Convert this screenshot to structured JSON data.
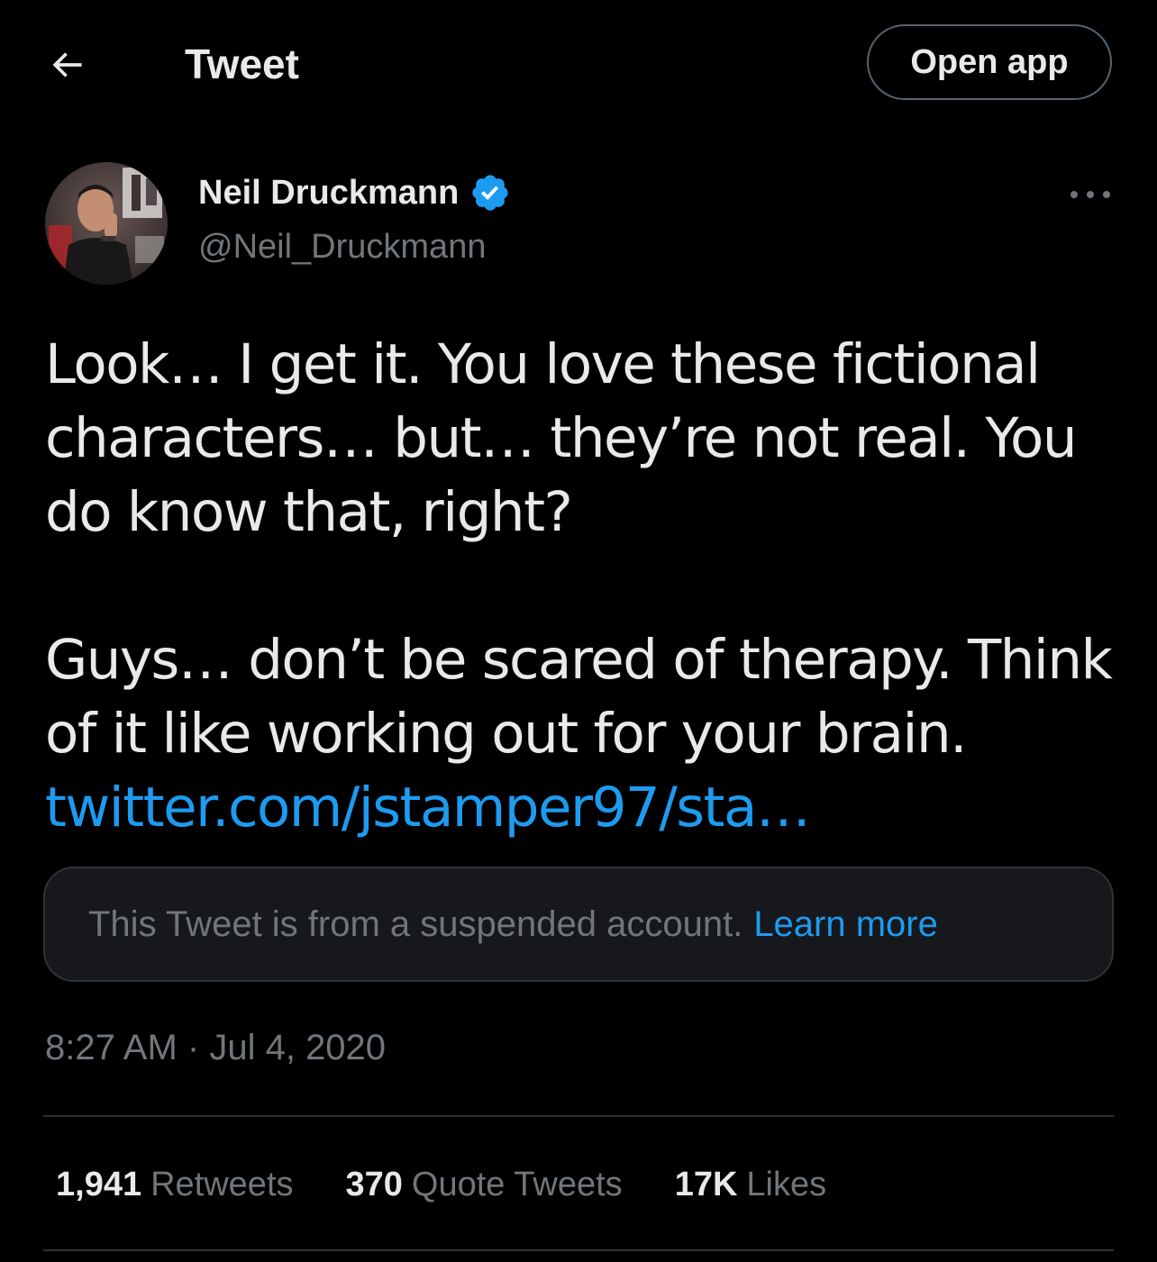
{
  "header": {
    "back_icon": "arrow-left-icon",
    "title": "Tweet",
    "open_app_label": "Open app"
  },
  "author": {
    "name": "Neil Druckmann",
    "handle": "@Neil_Druckmann",
    "verified_icon": "verified-badge-icon",
    "more_icon": "more-horizontal-icon"
  },
  "tweet": {
    "paragraph_1": "Look… I get it. You love these fictional characters… but… they’re not real. You do know that, right?",
    "paragraph_2_text": "Guys… don’t be scared of therapy. Think of it like working out for your brain.",
    "link_text": "twitter.com/jstamper97/sta…"
  },
  "quoted": {
    "suspended_text": "This Tweet is from a suspended account.",
    "learn_more": "Learn more"
  },
  "meta": {
    "time": "8:27 AM",
    "separator": "·",
    "date": "Jul 4, 2020"
  },
  "stats": {
    "retweets_count": "1,941",
    "retweets_label": "Retweets",
    "quotes_count": "370",
    "quotes_label": "Quote Tweets",
    "likes_count": "17K",
    "likes_label": "Likes"
  },
  "colors": {
    "background": "#000000",
    "text_primary": "#e7e9ea",
    "text_secondary": "#71767b",
    "accent": "#1d9bf0",
    "border": "#2f3336"
  }
}
